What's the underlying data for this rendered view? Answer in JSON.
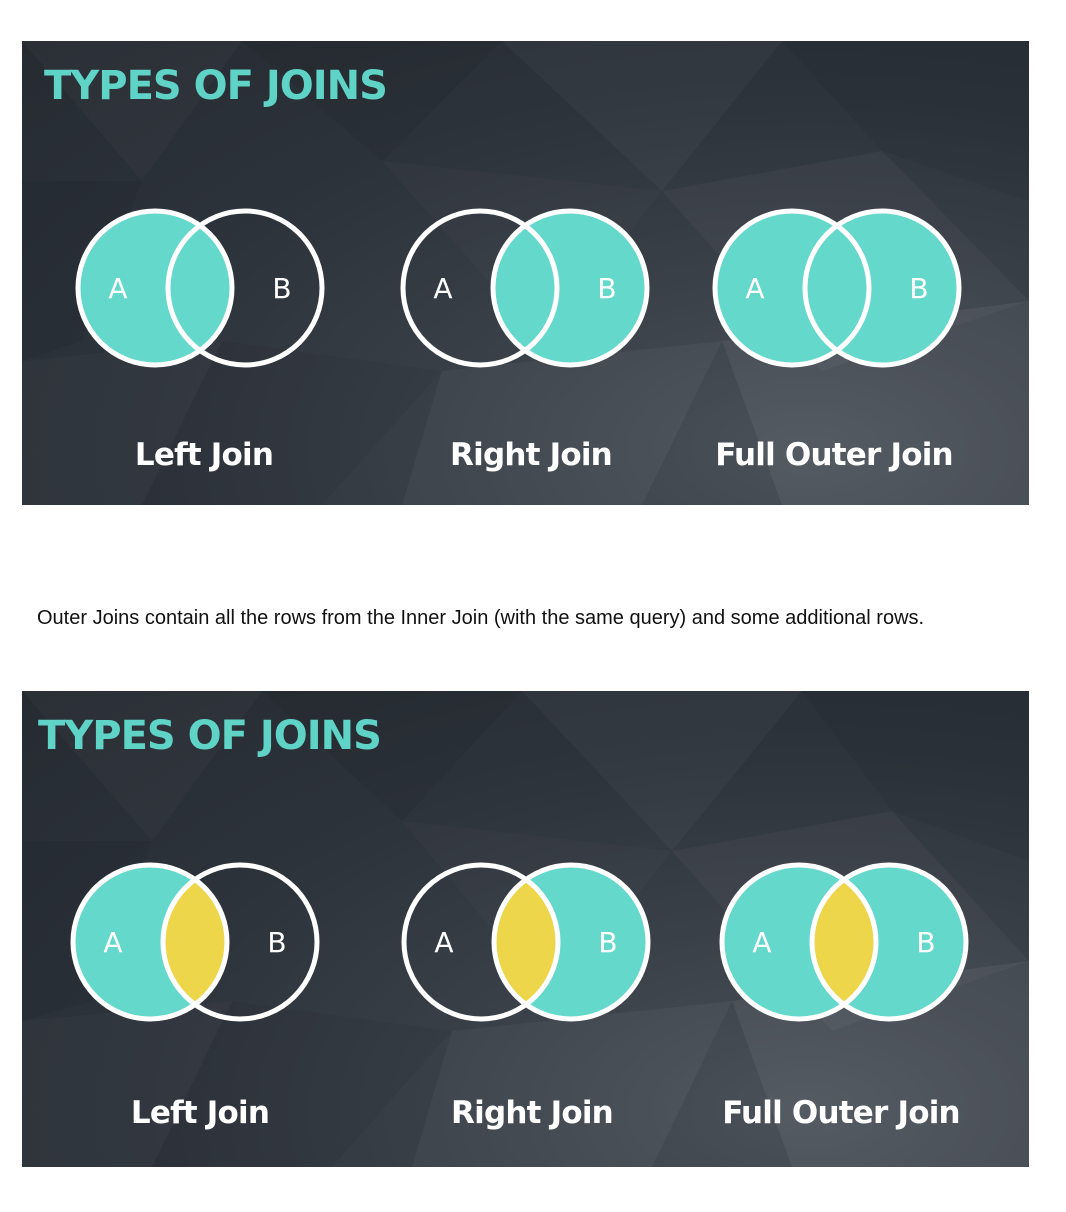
{
  "colors": {
    "accent": "#64d8cb",
    "title": "#5fd3c6",
    "intersection": "#eed64b",
    "outline": "#ffffff",
    "background": "#2d333b"
  },
  "slides": [
    {
      "title": "TYPES OF JOINS",
      "joins": [
        {
          "label": "Left Join",
          "set_a": "A",
          "set_b": "B",
          "fill_a": true,
          "fill_b": false,
          "intersection": "accent"
        },
        {
          "label": "Right Join",
          "set_a": "A",
          "set_b": "B",
          "fill_a": false,
          "fill_b": true,
          "intersection": "accent"
        },
        {
          "label": "Full Outer Join",
          "set_a": "A",
          "set_b": "B",
          "fill_a": true,
          "fill_b": true,
          "intersection": "accent"
        }
      ]
    },
    {
      "title": "TYPES OF JOINS",
      "joins": [
        {
          "label": "Left Join",
          "set_a": "A",
          "set_b": "B",
          "fill_a": true,
          "fill_b": false,
          "intersection": "highlight"
        },
        {
          "label": "Right Join",
          "set_a": "A",
          "set_b": "B",
          "fill_a": false,
          "fill_b": true,
          "intersection": "highlight"
        },
        {
          "label": "Full Outer Join",
          "set_a": "A",
          "set_b": "B",
          "fill_a": true,
          "fill_b": true,
          "intersection": "highlight"
        }
      ]
    }
  ],
  "caption": "Outer Joins contain all the rows from the Inner Join (with the same query) and some additional rows."
}
